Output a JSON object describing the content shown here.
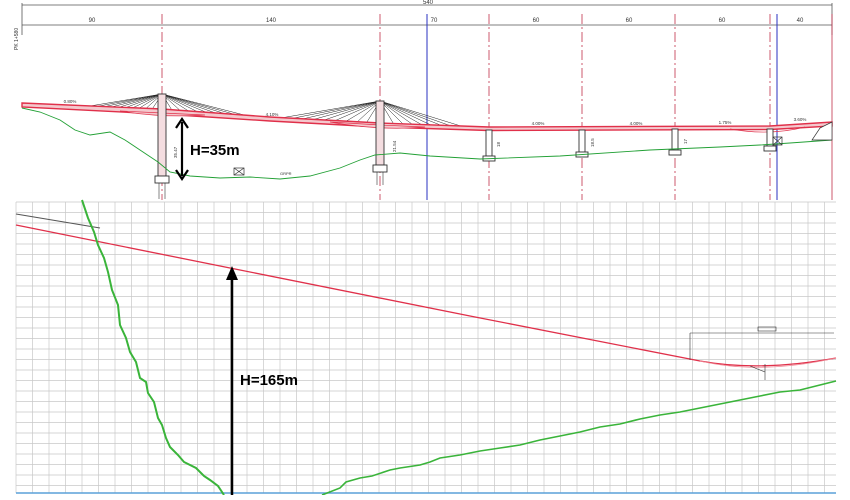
{
  "top_panel": {
    "overall_length": "540",
    "spans": [
      "90",
      "140",
      "70",
      "60",
      "60",
      "60",
      "40"
    ],
    "station_label": "PK 1+580",
    "deck_slopes": [
      "0.80%",
      "4.10%",
      "4.00%",
      "4.00%",
      "1.75%",
      "3.60%"
    ],
    "pier_heights": [
      "35.47",
      "21.54",
      "18",
      "18.5",
      "17"
    ],
    "ground_label": "GRPR",
    "height_annotation": "H=35m"
  },
  "bottom_panel": {
    "height_annotation": "H=165m"
  },
  "colors": {
    "deck": "#e0304a",
    "terrain": "#22a035",
    "axis": "#c0304a",
    "blue_line": "#2a30c0",
    "grid": "#c8c8c8"
  }
}
